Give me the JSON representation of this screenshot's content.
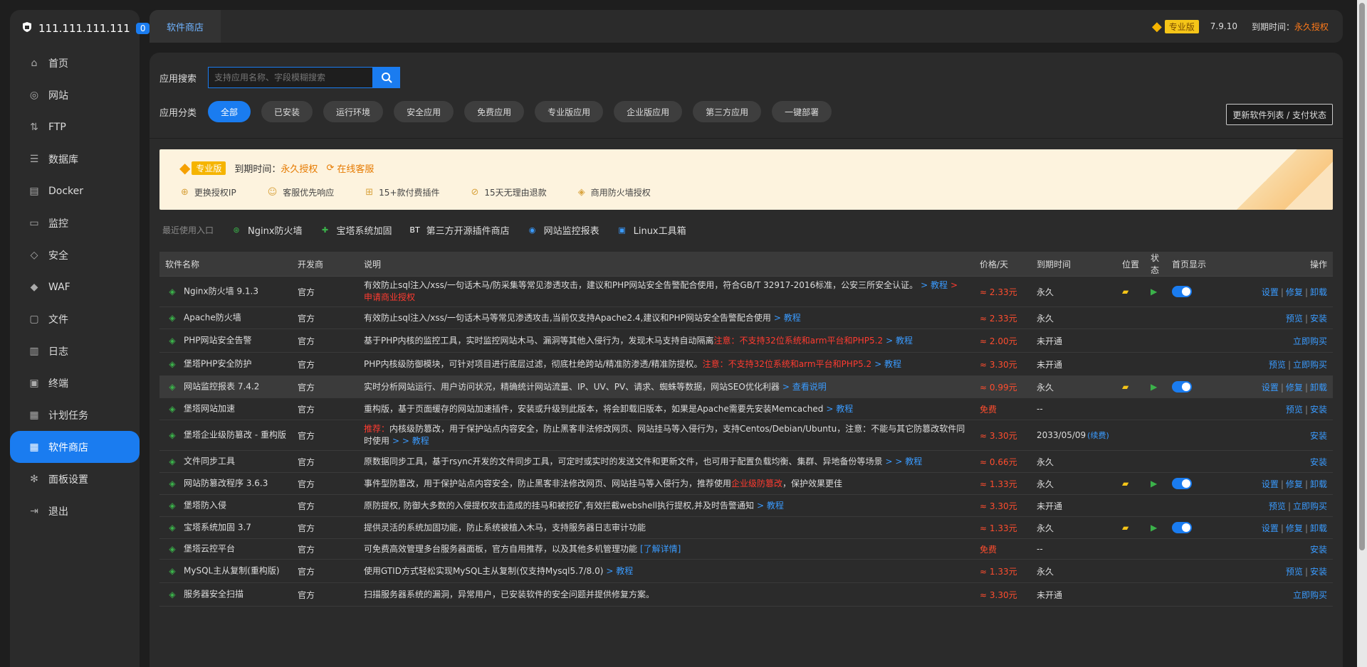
{
  "sidebar": {
    "host_ip": "111.111.111.111",
    "badge_count": "0",
    "items": [
      {
        "label": "首页",
        "icon": "home-icon"
      },
      {
        "label": "网站",
        "icon": "globe-icon"
      },
      {
        "label": "FTP",
        "icon": "ftp-icon"
      },
      {
        "label": "数据库",
        "icon": "database-icon"
      },
      {
        "label": "Docker",
        "icon": "docker-icon"
      },
      {
        "label": "监控",
        "icon": "monitor-icon"
      },
      {
        "label": "安全",
        "icon": "shield-icon"
      },
      {
        "label": "WAF",
        "icon": "waf-icon"
      },
      {
        "label": "文件",
        "icon": "folder-icon"
      },
      {
        "label": "日志",
        "icon": "log-icon"
      },
      {
        "label": "终端",
        "icon": "terminal-icon"
      },
      {
        "label": "计划任务",
        "icon": "calendar-icon"
      },
      {
        "label": "软件商店",
        "icon": "store-icon",
        "active": true
      },
      {
        "label": "面板设置",
        "icon": "gear-icon"
      },
      {
        "label": "退出",
        "icon": "logout-icon"
      }
    ]
  },
  "header": {
    "tab": "软件商店",
    "edition": "专业版",
    "version": "7.9.10",
    "expire_label": "到期时间：",
    "expire_value": "永久授权"
  },
  "search": {
    "label": "应用搜索",
    "placeholder": "支持应用名称、字段模糊搜索"
  },
  "categories": {
    "label": "应用分类",
    "items": [
      "全部",
      "已安装",
      "运行环境",
      "安全应用",
      "免费应用",
      "专业版应用",
      "企业版应用",
      "第三方应用",
      "一键部署"
    ],
    "refresh_label": "更新软件列表 / 支付状态"
  },
  "banner": {
    "edition": "专业版",
    "expire_label": "到期时间：",
    "expire_value": "永久授权",
    "service": "在线客服",
    "features": [
      "更换授权IP",
      "客服优先响应",
      "15+款付费插件",
      "15天无理由退款",
      "商用防火墙授权"
    ]
  },
  "recent": {
    "label": "最近使用入口",
    "items": [
      {
        "label": "Nginx防火墙",
        "icon": "nginx-firewall-icon"
      },
      {
        "label": "宝塔系统加固",
        "icon": "shield-plus-icon"
      },
      {
        "label": "第三方开源插件商店",
        "icon": "bt-icon"
      },
      {
        "label": "网站监控报表",
        "icon": "chart-globe-icon"
      },
      {
        "label": "Linux工具箱",
        "icon": "toolbox-icon"
      }
    ]
  },
  "table": {
    "headers": {
      "name": "软件名称",
      "dev": "开发商",
      "desc": "说明",
      "price": "价格/天",
      "expire": "到期时间",
      "pos": "位置",
      "status": "状态",
      "home": "首页显示",
      "ops": "操作"
    },
    "rows": [
      {
        "name": "Nginx防火墙 9.1.3",
        "dev": "官方",
        "desc": "有效防止sql注入/xss/一句话木马/防采集等常见渗透攻击，建议和PHP网站安全告警配合使用，符合GB/T 32917-2016标准，公安三所安全认证。",
        "link": "> 教程",
        "red_tail": "> 申请商业授权",
        "price": "≈ 2.33元",
        "expire": "永久",
        "installed": true,
        "ops": [
          "设置",
          "修复",
          "卸载"
        ]
      },
      {
        "name": "Apache防火墙",
        "dev": "官方",
        "desc": "有效防止sql注入/xss/一句话木马等常见渗透攻击,当前仅支持Apache2.4,建议和PHP网站安全告警配合使用",
        "link": "> 教程",
        "price": "≈ 2.33元",
        "expire": "永久",
        "installed": false,
        "ops": [
          "预览",
          "安装"
        ]
      },
      {
        "name": "PHP网站安全告警",
        "dev": "官方",
        "desc": "基于PHP内核的监控工具，实时监控网站木马、漏洞等其他入侵行为，发现木马支持自动隔离",
        "red": "注意：不支持32位系统和arm平台和PHP5.2",
        "link": "> 教程",
        "price": "≈ 2.00元",
        "expire": "未开通",
        "installed": false,
        "ops": [
          "立即购买"
        ]
      },
      {
        "name": "堡塔PHP安全防护",
        "dev": "官方",
        "desc": "PHP内核级防御模块，可针对项目进行底层过滤，彻底杜绝跨站/精准防渗透/精准防提权。",
        "red": "注意：不支持32位系统和arm平台和PHP5.2",
        "link": "> 教程",
        "price": "≈ 3.30元",
        "expire": "未开通",
        "installed": false,
        "ops": [
          "预览",
          "立即购买"
        ]
      },
      {
        "name": "网站监控报表 7.4.2",
        "dev": "官方",
        "desc": "实时分析网站运行、用户访问状况，精确统计网站流量、IP、UV、PV、请求、蜘蛛等数据，网站SEO优化利器",
        "link": "> 查看说明",
        "price": "≈ 0.99元",
        "expire": "永久",
        "installed": true,
        "highlight": true,
        "ops": [
          "设置",
          "修复",
          "卸载"
        ]
      },
      {
        "name": "堡塔网站加速",
        "dev": "官方",
        "desc": "重构版，基于页面缓存的网站加速插件，安装或升级到此版本，将会卸载旧版本，如果是Apache需要先安装Memcached",
        "link": "> 教程",
        "price": "免费",
        "expire": "--",
        "installed": false,
        "ops": [
          "预览",
          "安装"
        ]
      },
      {
        "name": "堡塔企业级防篡改 - 重构版",
        "dev": "官方",
        "desc": "内核级防篡改，用于保护站点内容安全，防止黑客非法修改网页、网站挂马等入侵行为，支持Centos/Debian/Ubuntu，注意：不能与其它防篡改软件同时使用",
        "red_head": "推荐：",
        "link": "> > 教程",
        "price": "≈ 3.30元",
        "expire": "2033/05/09",
        "renew": "(续费)",
        "installed": false,
        "ops": [
          "安装"
        ]
      },
      {
        "name": "文件同步工具",
        "dev": "官方",
        "desc": "原数据同步工具，基于rsync开发的文件同步工具，可定时或实时的发送文件和更新文件，也可用于配置负载均衡、集群、异地备份等场景",
        "link": "> > 教程",
        "price": "≈ 0.66元",
        "expire": "永久",
        "installed": false,
        "ops": [
          "安装"
        ]
      },
      {
        "name": "网站防篡改程序 3.6.3",
        "dev": "官方",
        "desc": "事件型防篡改，用于保护站点内容安全，防止黑客非法修改网页、网站挂马等入侵行为，推荐使用",
        "red": "企业级防篡改",
        "desc_tail": "，保护效果更佳",
        "price": "≈ 1.33元",
        "expire": "永久",
        "installed": true,
        "ops": [
          "设置",
          "修复",
          "卸载"
        ]
      },
      {
        "name": "堡塔防入侵",
        "dev": "官方",
        "desc": "原防提权, 防御大多数的入侵提权攻击造成的挂马和被挖矿,有效拦截webshell执行提权,并及时告警通知",
        "link": "> 教程",
        "price": "≈ 3.30元",
        "expire": "未开通",
        "installed": false,
        "ops": [
          "预览",
          "立即购买"
        ]
      },
      {
        "name": "宝塔系统加固 3.7",
        "dev": "官方",
        "desc": "提供灵活的系统加固功能，防止系统被植入木马，支持服务器日志审计功能",
        "price": "≈ 1.33元",
        "expire": "永久",
        "installed": true,
        "ops": [
          "设置",
          "修复",
          "卸载"
        ]
      },
      {
        "name": "堡塔云控平台",
        "dev": "官方",
        "desc": "可免费高效管理多台服务器面板，官方自用推荐，以及其他多机管理功能",
        "link": "[了解详情]",
        "price": "免费",
        "expire": "--",
        "installed": false,
        "ops": [
          "安装"
        ]
      },
      {
        "name": "MySQL主从复制(重构版)",
        "dev": "官方",
        "desc": "使用GTID方式轻松实现MySQL主从复制(仅支持Mysql5.7/8.0)",
        "link": "> 教程",
        "price": "≈ 1.33元",
        "expire": "永久",
        "installed": false,
        "ops": [
          "预览",
          "安装"
        ]
      },
      {
        "name": "服务器安全扫描",
        "dev": "官方",
        "desc": "扫描服务器系统的漏洞，异常用户，已安装软件的安全问题并提供修复方案。",
        "price": "≈ 3.30元",
        "expire": "未开通",
        "installed": false,
        "ops": [
          "立即购买"
        ]
      }
    ]
  }
}
